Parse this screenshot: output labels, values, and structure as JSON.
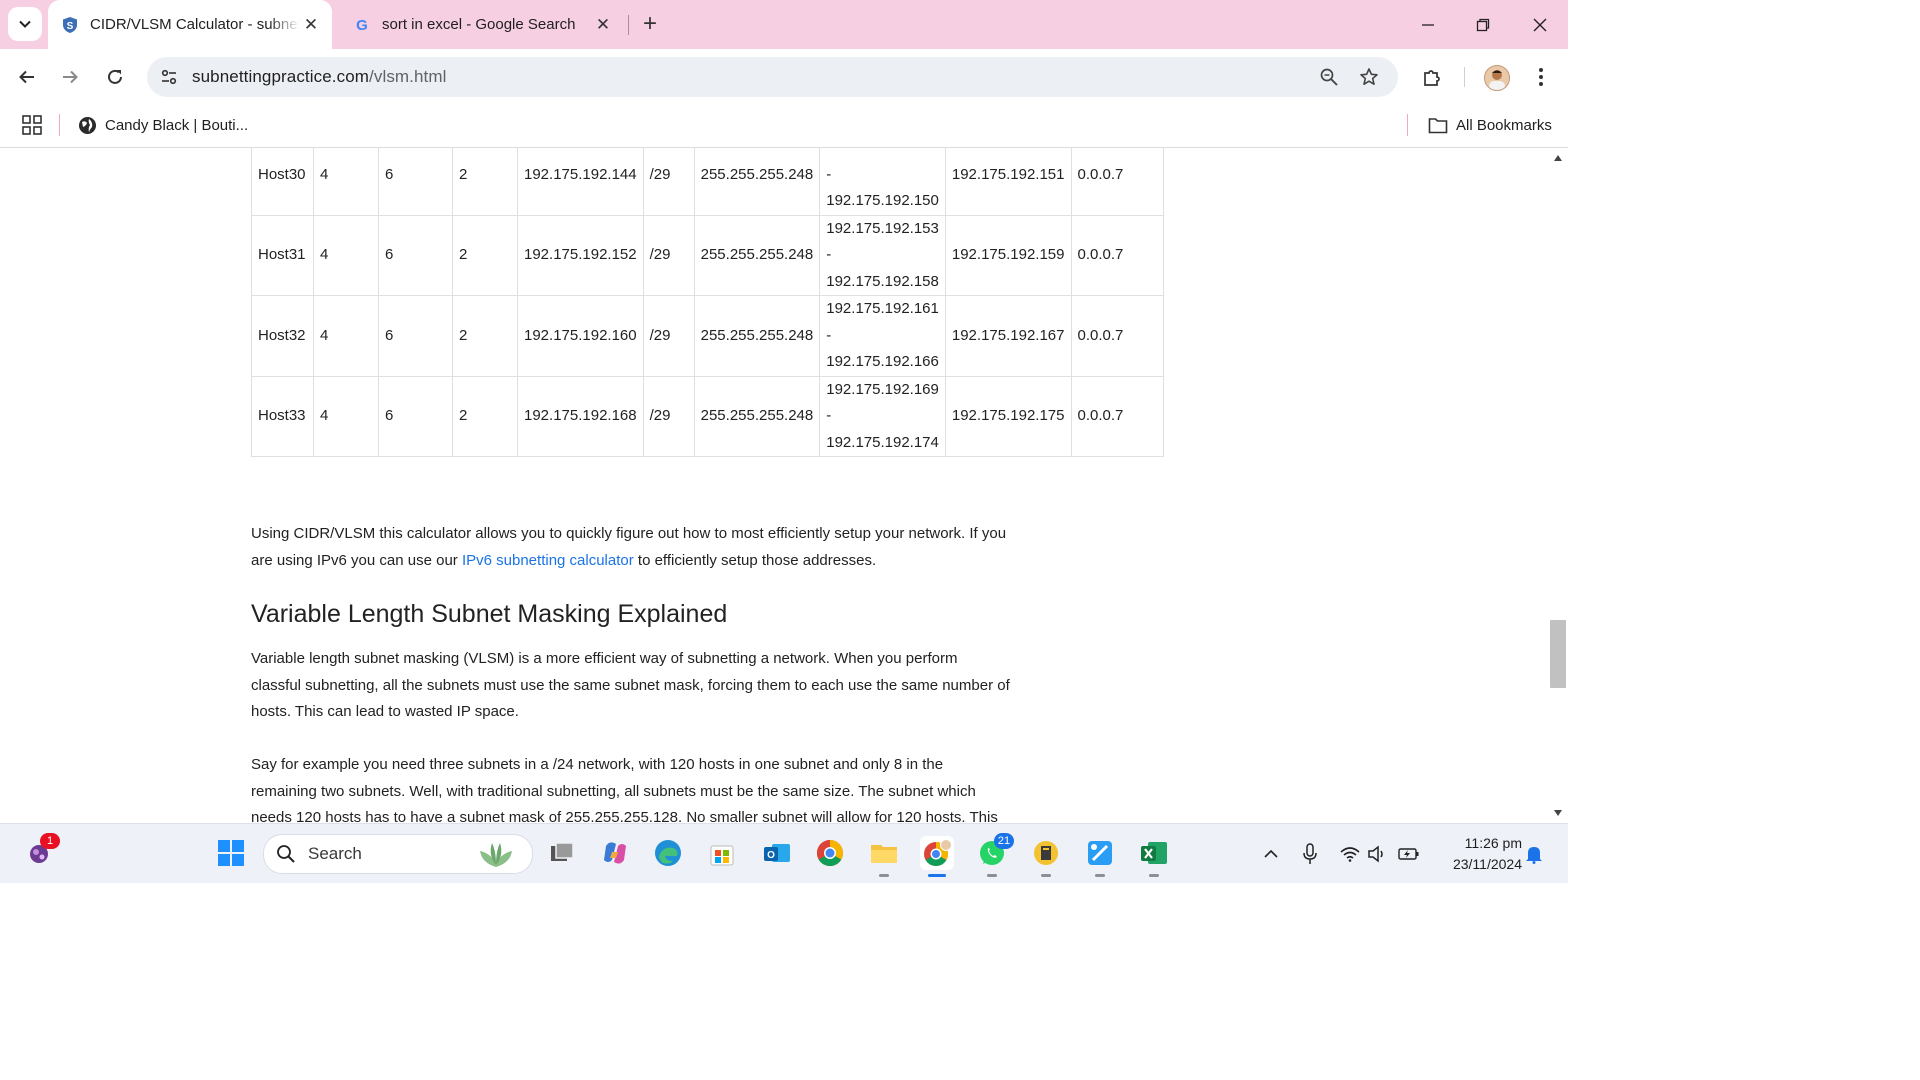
{
  "browser": {
    "tabs": [
      {
        "title": "CIDR/VLSM Calculator - subnetti",
        "active": true
      },
      {
        "title": "sort in excel - Google Search",
        "active": false
      }
    ],
    "new_tab_symbol": "+",
    "close_symbol": "✕",
    "url_domain": "subnettingpractice.com",
    "url_path": "/vlsm.html",
    "bookmarks": [
      {
        "label": "Candy Black | Bouti...",
        "icon": "globe-icon"
      }
    ],
    "all_bookmarks_label": "All Bookmarks"
  },
  "page": {
    "table": {
      "rows": [
        {
          "name": "Host30",
          "needed": "4",
          "available": "6",
          "unused": "2",
          "network": "192.175.192.144",
          "slash": "/29",
          "mask": "255.255.255.248",
          "range_start": "",
          "range_sep": "-",
          "range_end": "192.175.192.150",
          "broadcast": "192.175.192.151",
          "wildcard": "0.0.0.7"
        },
        {
          "name": "Host31",
          "needed": "4",
          "available": "6",
          "unused": "2",
          "network": "192.175.192.152",
          "slash": "/29",
          "mask": "255.255.255.248",
          "range_start": "192.175.192.153",
          "range_sep": "-",
          "range_end": "192.175.192.158",
          "broadcast": "192.175.192.159",
          "wildcard": "0.0.0.7"
        },
        {
          "name": "Host32",
          "needed": "4",
          "available": "6",
          "unused": "2",
          "network": "192.175.192.160",
          "slash": "/29",
          "mask": "255.255.255.248",
          "range_start": "192.175.192.161",
          "range_sep": "-",
          "range_end": "192.175.192.166",
          "broadcast": "192.175.192.167",
          "wildcard": "0.0.0.7"
        },
        {
          "name": "Host33",
          "needed": "4",
          "available": "6",
          "unused": "2",
          "network": "192.175.192.168",
          "slash": "/29",
          "mask": "255.255.255.248",
          "range_start": "192.175.192.169",
          "range_sep": "-",
          "range_end": "192.175.192.174",
          "broadcast": "192.175.192.175",
          "wildcard": "0.0.0.7"
        }
      ]
    },
    "intro_text_before_link": "Using CIDR/VLSM this calculator allows you to quickly figure out how to most efficiently setup your network. If you are using IPv6 you can use our ",
    "intro_link": "IPv6 subnetting calculator",
    "intro_text_after_link": " to efficiently setup those addresses.",
    "heading": "Variable Length Subnet Masking Explained",
    "paragraph1": "Variable length subnet masking (VLSM) is a more efficient way of subnetting a network. When you perform classful subnetting, all the subnets must use the same subnet mask, forcing them to each use the same number of hosts. This can lead to wasted IP space.",
    "paragraph2": "Say for example you need three subnets in a /24 network, with 120 hosts in one subnet and only 8 in the remaining two subnets. Well, with traditional subnetting, all subnets must be the same size. The subnet which needs 120 hosts has to have a subnet mask of 255.255.255.128. No smaller subnet will allow for 120 hosts. This means the"
  },
  "taskbar": {
    "search_label": "Search",
    "widget_badge": "1",
    "whatsapp_badge": "21",
    "time": "11:26 pm",
    "date": "23/11/2024"
  },
  "colors": {
    "tabstrip": "#f6cfe2",
    "link": "#1a73e8",
    "omnibox": "#eceff4"
  }
}
